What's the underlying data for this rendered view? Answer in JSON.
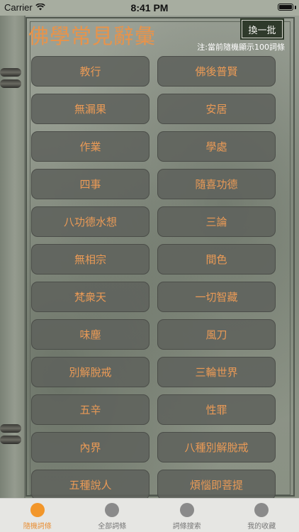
{
  "status_bar": {
    "carrier": "Carrier",
    "time": "8:41 PM"
  },
  "header": {
    "title": "佛學常見辭彙",
    "refresh_label": "換一批",
    "note": "注:當前隨機顯示100詞條"
  },
  "terms": [
    "教行",
    "佛後普賢",
    "無漏果",
    "安居",
    "作業",
    "學處",
    "四事",
    "隨喜功德",
    "八功德水想",
    "三論",
    "無相宗",
    "間色",
    "梵衆天",
    "一切智藏",
    "味塵",
    "風刀",
    "別解脫戒",
    "三輪世界",
    "五辛",
    "性罪",
    "內界",
    "八種別解脫戒",
    "五種說人",
    "煩惱即菩提"
  ],
  "tabs": [
    {
      "label": "隨機詞條",
      "active": true
    },
    {
      "label": "全部詞條",
      "active": false
    },
    {
      "label": "詞條搜索",
      "active": false
    },
    {
      "label": "我的收藏",
      "active": false
    }
  ],
  "colors": {
    "accent": "#e8934a",
    "button_bg": "#5f625c"
  }
}
